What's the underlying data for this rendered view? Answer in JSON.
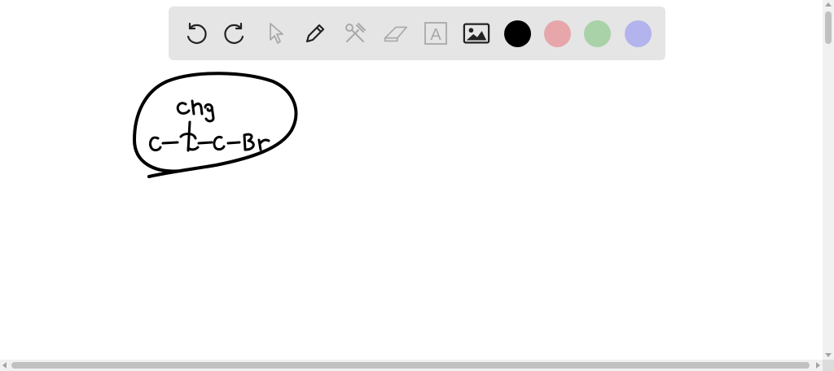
{
  "toolbar": {
    "tools": [
      {
        "id": "undo",
        "icon": "undo-icon"
      },
      {
        "id": "redo",
        "icon": "redo-icon"
      },
      {
        "id": "select",
        "icon": "pointer-icon"
      },
      {
        "id": "pen",
        "icon": "pencil-icon"
      },
      {
        "id": "tools",
        "icon": "tools-icon"
      },
      {
        "id": "eraser",
        "icon": "eraser-icon"
      },
      {
        "id": "text",
        "icon": "text-box-icon",
        "glyph": "A"
      },
      {
        "id": "image",
        "icon": "image-icon"
      }
    ],
    "colors": [
      "#000000",
      "#e6a6aa",
      "#a9d2a9",
      "#b3b3ee"
    ],
    "icon_color": "#222222",
    "disabled_icon_color": "#a9a9a9"
  },
  "canvas": {
    "ink_color": "#000000",
    "handwriting": [
      "CH3",
      "C–C–C–Br"
    ]
  }
}
